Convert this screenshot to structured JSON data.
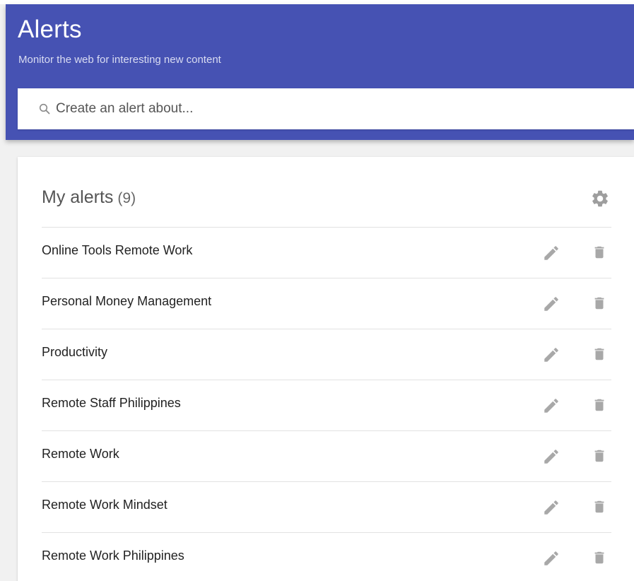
{
  "header": {
    "title": "Alerts",
    "subtitle": "Monitor the web for interesting new content"
  },
  "search": {
    "placeholder": "Create an alert about...",
    "icon": "search-icon"
  },
  "my_alerts": {
    "title": "My alerts",
    "count": "(9)",
    "settings_icon": "gear-icon",
    "items": [
      {
        "label": "Online Tools Remote Work"
      },
      {
        "label": "Personal Money Management"
      },
      {
        "label": "Productivity"
      },
      {
        "label": "Remote Staff Philippines"
      },
      {
        "label": "Remote Work"
      },
      {
        "label": "Remote Work Mindset"
      },
      {
        "label": "Remote Work Philippines"
      }
    ],
    "item_icons": [
      "pencil-icon",
      "trash-icon"
    ]
  },
  "colors": {
    "header_bg": "#4652b3",
    "icon_gray": "#9e9e9e"
  }
}
